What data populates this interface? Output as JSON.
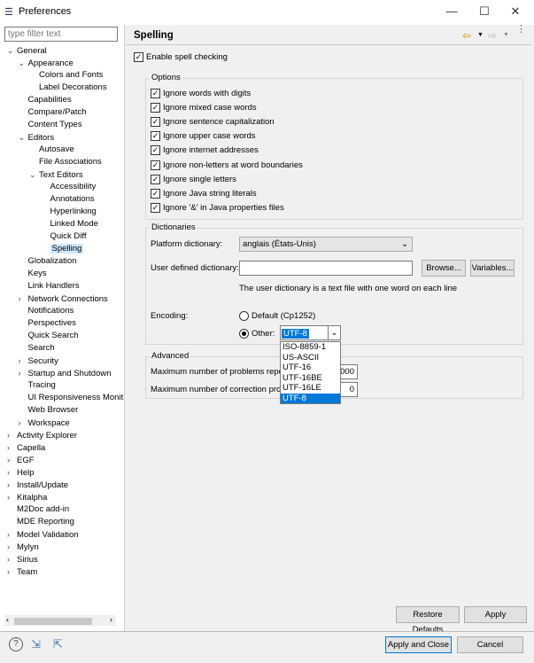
{
  "window": {
    "title": "Preferences",
    "app_icon": "preferences-icon"
  },
  "sidebar": {
    "filter_placeholder": "type filter text",
    "items": [
      {
        "label": "General",
        "level": 0,
        "state": "expanded"
      },
      {
        "label": "Appearance",
        "level": 1,
        "state": "expanded"
      },
      {
        "label": "Colors and Fonts",
        "level": 2
      },
      {
        "label": "Label Decorations",
        "level": 2
      },
      {
        "label": "Capabilities",
        "level": 1
      },
      {
        "label": "Compare/Patch",
        "level": 1
      },
      {
        "label": "Content Types",
        "level": 1
      },
      {
        "label": "Editors",
        "level": 1,
        "state": "expanded"
      },
      {
        "label": "Autosave",
        "level": 2
      },
      {
        "label": "File Associations",
        "level": 2
      },
      {
        "label": "Text Editors",
        "level": 2,
        "state": "expanded"
      },
      {
        "label": "Accessibility",
        "level": 3
      },
      {
        "label": "Annotations",
        "level": 3
      },
      {
        "label": "Hyperlinking",
        "level": 3
      },
      {
        "label": "Linked Mode",
        "level": 3
      },
      {
        "label": "Quick Diff",
        "level": 3
      },
      {
        "label": "Spelling",
        "level": 3,
        "selected": true
      },
      {
        "label": "Globalization",
        "level": 1
      },
      {
        "label": "Keys",
        "level": 1
      },
      {
        "label": "Link Handlers",
        "level": 1
      },
      {
        "label": "Network Connections",
        "level": 1,
        "state": "collapsed"
      },
      {
        "label": "Notifications",
        "level": 1
      },
      {
        "label": "Perspectives",
        "level": 1
      },
      {
        "label": "Quick Search",
        "level": 1
      },
      {
        "label": "Search",
        "level": 1
      },
      {
        "label": "Security",
        "level": 1,
        "state": "collapsed"
      },
      {
        "label": "Startup and Shutdown",
        "level": 1,
        "state": "collapsed"
      },
      {
        "label": "Tracing",
        "level": 1
      },
      {
        "label": "UI Responsiveness Monit",
        "level": 1
      },
      {
        "label": "Web Browser",
        "level": 1
      },
      {
        "label": "Workspace",
        "level": 1,
        "state": "collapsed"
      },
      {
        "label": "Activity Explorer",
        "level": 0,
        "state": "collapsed"
      },
      {
        "label": "Capella",
        "level": 0,
        "state": "collapsed"
      },
      {
        "label": "EGF",
        "level": 0,
        "state": "collapsed"
      },
      {
        "label": "Help",
        "level": 0,
        "state": "collapsed"
      },
      {
        "label": "Install/Update",
        "level": 0,
        "state": "collapsed"
      },
      {
        "label": "Kitalpha",
        "level": 0,
        "state": "collapsed"
      },
      {
        "label": "M2Doc add-in",
        "level": 0
      },
      {
        "label": "MDE Reporting",
        "level": 0
      },
      {
        "label": "Model Validation",
        "level": 0,
        "state": "collapsed"
      },
      {
        "label": "Mylyn",
        "level": 0,
        "state": "collapsed"
      },
      {
        "label": "Sirius",
        "level": 0,
        "state": "collapsed"
      },
      {
        "label": "Team",
        "level": 0,
        "state": "collapsed"
      }
    ]
  },
  "page": {
    "title": "Spelling",
    "enable_label": "Enable spell checking",
    "options_label": "Options",
    "options": [
      "Ignore words with digits",
      "Ignore mixed case words",
      "Ignore sentence capitalization",
      "Ignore upper case words",
      "Ignore internet addresses",
      "Ignore non-letters at word boundaries",
      "Ignore single letters",
      "Ignore Java string literals",
      "Ignore '&' in Java properties files"
    ],
    "dictionaries_label": "Dictionaries",
    "platform_dict_label": "Platform dictionary:",
    "platform_dict_value": "anglais (États-Unis)",
    "user_dict_label": "User defined dictionary:",
    "user_dict_value": "",
    "browse_label": "Browse...",
    "variables_label": "Variables...",
    "user_dict_hint": "The user dictionary is a text file with one word on each line",
    "encoding_label": "Encoding:",
    "encoding_default_label": "Default (Cp1252)",
    "encoding_other_label": "Other:",
    "encoding_value": "UTF-8",
    "encoding_options": [
      "ISO-8859-1",
      "US-ASCII",
      "UTF-16",
      "UTF-16BE",
      "UTF-16LE",
      "UTF-8"
    ],
    "advanced_label": "Advanced",
    "max_problems_label": "Maximum number of problems reported per file:",
    "max_problems_visible": "000",
    "max_corrections_label": "Maximum number of correction proposals:",
    "max_corrections_visible": "0",
    "restore_label": "Restore Defaults",
    "apply_label": "Apply"
  },
  "footer": {
    "apply_close_label": "Apply and Close",
    "cancel_label": "Cancel"
  },
  "colors": {
    "accent": "#0078d7",
    "selection": "#cce8ff",
    "back_arrow": "#e08a00"
  }
}
